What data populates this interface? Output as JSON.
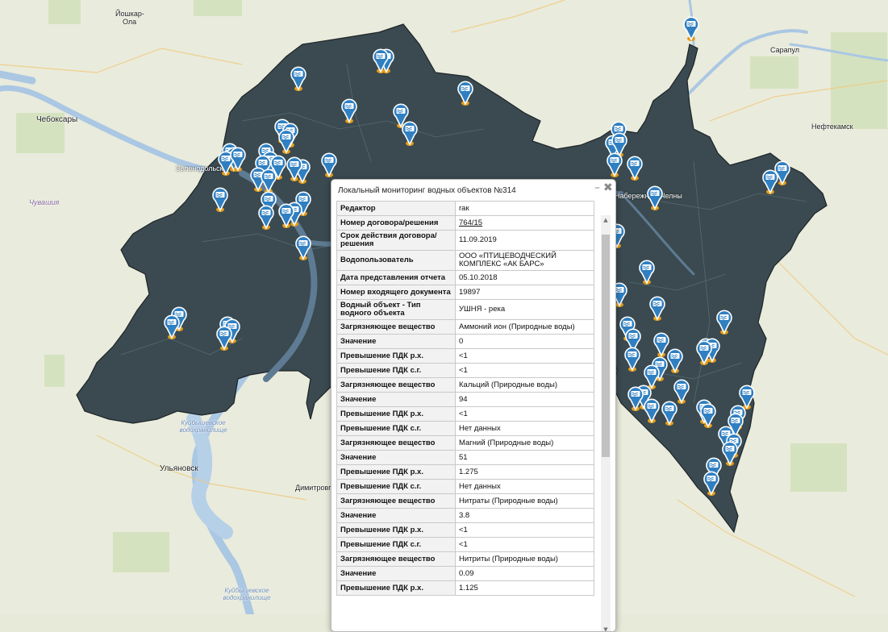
{
  "map": {
    "labels": {
      "yoshkar_ola": "Йошкар-\nОла",
      "cheboksary": "Чебоксары",
      "chuvashia": "Чувашия",
      "zelenodolsk": "Зеленодольск",
      "sarapul": "Сарапул",
      "neftekamsk": "Нефтекамск",
      "naberezhnye": "Набережные Челны",
      "kuibyshev_res_1": "Куйбышевское водохранилище",
      "kuibyshev_res_2": "Куйбышевское водохранилище",
      "ulyanovsk": "Ульяновск",
      "dimitrovgrad": "Димитровград"
    },
    "colors": {
      "region_fill": "#3a4a50",
      "background": "#e9ebdc",
      "water": "#aac7e3",
      "marker": "#2f7fc1",
      "marker_tip": "#e59c1a"
    },
    "marker_icon": "water-body-icon"
  },
  "popup": {
    "title": "Локальный мониторинг водных объектов №314",
    "minimize_icon": "minimize-icon",
    "close_icon": "close-icon",
    "minimize_glyph": "–",
    "close_glyph": "✖",
    "rows": [
      {
        "key": "Редактор",
        "value": "rак"
      },
      {
        "key": "Номер договора/решения",
        "value": "764/15",
        "link": true
      },
      {
        "key": "Срок действия договора/решения",
        "value": "11.09.2019"
      },
      {
        "key": "Водопользователь",
        "value": "ООО «ПТИЦЕВОДЧЕСКИЙ КОМПЛЕКС «АК БАРС»"
      },
      {
        "key": "Дата представления отчета",
        "value": "05.10.2018"
      },
      {
        "key": "Номер входящего документа",
        "value": "19897"
      },
      {
        "key": "Водный объект - Тип водного объекта",
        "value": "УШНЯ - река"
      },
      {
        "key": "Загрязняющее вещество",
        "value": "Аммоний ион (Природные воды)"
      },
      {
        "key": "Значение",
        "value": "0"
      },
      {
        "key": "Превышение ПДК р.х.",
        "value": "<1"
      },
      {
        "key": "Превышение ПДК с.г.",
        "value": "<1"
      },
      {
        "key": "Загрязняющее вещество",
        "value": "Кальций (Природные воды)"
      },
      {
        "key": "Значение",
        "value": "94"
      },
      {
        "key": "Превышение ПДК р.х.",
        "value": "<1"
      },
      {
        "key": "Превышение ПДК с.г.",
        "value": "Нет данных"
      },
      {
        "key": "Загрязняющее вещество",
        "value": "Магний (Природные воды)"
      },
      {
        "key": "Значение",
        "value": "51"
      },
      {
        "key": "Превышение ПДК р.х.",
        "value": "1.275"
      },
      {
        "key": "Превышение ПДК с.г.",
        "value": "Нет данных"
      },
      {
        "key": "Загрязняющее вещество",
        "value": "Нитраты (Природные воды)"
      },
      {
        "key": "Значение",
        "value": "3.8"
      },
      {
        "key": "Превышение ПДК р.х.",
        "value": "<1"
      },
      {
        "key": "Превышение ПДК с.г.",
        "value": "<1"
      },
      {
        "key": "Загрязняющее вещество",
        "value": "Нитриты (Природные воды)"
      },
      {
        "key": "Значение",
        "value": "0.09"
      },
      {
        "key": "Превышение ПДК р.х.",
        "value": "1.125"
      }
    ]
  }
}
